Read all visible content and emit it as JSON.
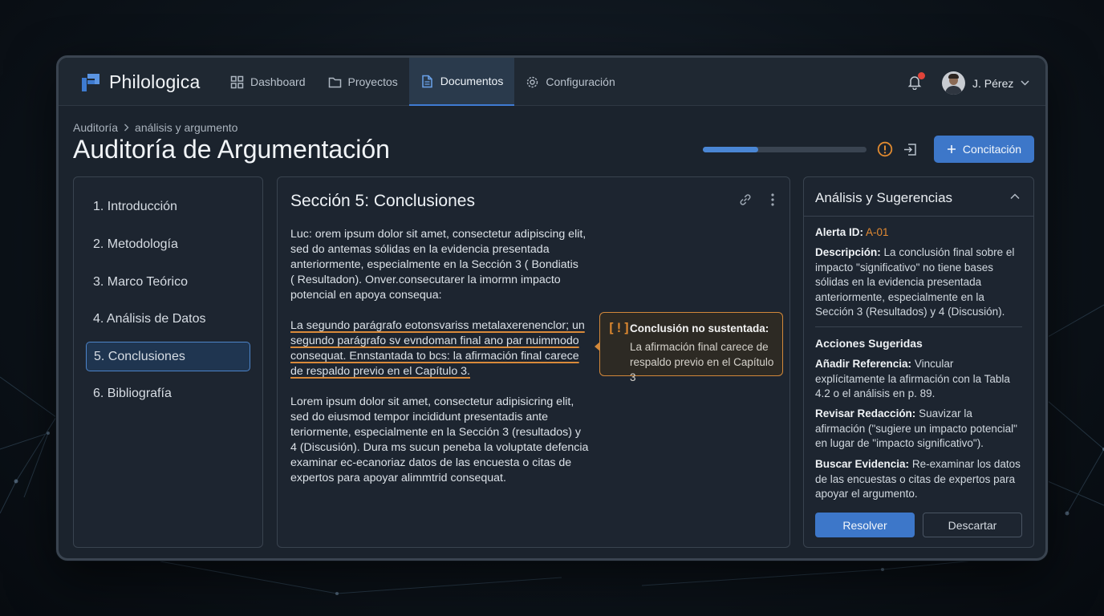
{
  "app": {
    "name": "Philologica"
  },
  "nav": {
    "items": [
      {
        "label": "Dashboard",
        "icon": "grid-icon"
      },
      {
        "label": "Proyectos",
        "icon": "folder-icon"
      },
      {
        "label": "Documentos",
        "icon": "document-icon",
        "active": true
      },
      {
        "label": "Configuración",
        "icon": "gear-icon"
      }
    ]
  },
  "user": {
    "name": "J. Pérez"
  },
  "breadcrumb": {
    "root": "Auditoría",
    "current": "análisis y argumento"
  },
  "page": {
    "title": "Auditoría de Argumentación",
    "progress": 0.34,
    "action_label": "Concitación"
  },
  "toc": {
    "items": [
      {
        "label": "1. Introducción"
      },
      {
        "label": "2. Metodología"
      },
      {
        "label": "3. Marco Teórico"
      },
      {
        "label": "4. Análisis de Datos"
      },
      {
        "label": "5. Conclusiones",
        "active": true
      },
      {
        "label": "6. Bibliografía"
      }
    ]
  },
  "document": {
    "section_title": "Sección 5: Conclusiones",
    "paragraphs": [
      "Luc: orem ipsum dolor sit amet, consectetur adipiscing elit,\nsed do antemas sólidas en la evidencia presentada\nanteriormente, especialmente en la Sección 3 ( Bondiatis\n( Resultadon). Onver.consecutarer la imormn impacto\npotencial en apoya consequa:",
      "La segundo parágrafo eotonsvariss metalaxerenenclor; un\nsegundo parágrafo sv evndoman final ano par nuimmodo\nconsequat. Ennstantada to bcs: la afirmación final carece\nde respaldo previo en el Capítulo 3.",
      "Lorem ipsum dolor sit amet, consectetur adipisicring elit,\nsed do eiusmod tempor incididunt presentadis ante\nteriormente, especialmente en la Sección 3 (resultados) y\n4 (Discusión). Dura ms sucun peneba la voluptate defencia\nexaminar ec-ecanoriaz datos de las encuesta o citas de\nexpertos para apoyar alimmtrid consequat."
    ],
    "callout": {
      "icon_text": "[!]",
      "title": "Conclusión no sustentada:",
      "body": "La afirmación final carece de respaldo previo en el Capítulo 3"
    }
  },
  "analysis": {
    "title": "Análisis y Sugerencias",
    "alert_label": "Alerta ID:",
    "alert_id": "A-01",
    "description_label": "Descripción:",
    "description": "La conclusión final sobre el impacto \"significativo\" no tiene bases sólidas en la evidencia presentada anteriormente, especialmente en la Sección 3 (Resultados) y 4 (Discusión).",
    "actions_title": "Acciones Sugeridas",
    "actions": [
      {
        "label": "Añadir Referencia:",
        "text": "Vincular explícitamente la afirmación con la Tabla 4.2 o el análisis en p. 89."
      },
      {
        "label": "Revisar Redacción:",
        "text": "Suavizar la afirmación (\"sugiere un impacto potencial\" en lugar de \"impacto significativo\")."
      },
      {
        "label": "Buscar Evidencia:",
        "text": "Re-examinar los datos de las encuestas o citas de expertos para apoyar el argumento."
      }
    ],
    "resolve_label": "Resolver",
    "discard_label": "Descartar"
  },
  "colors": {
    "accent": "#3d77c9",
    "warning": "#e08a30",
    "badge": "#e0443a"
  }
}
